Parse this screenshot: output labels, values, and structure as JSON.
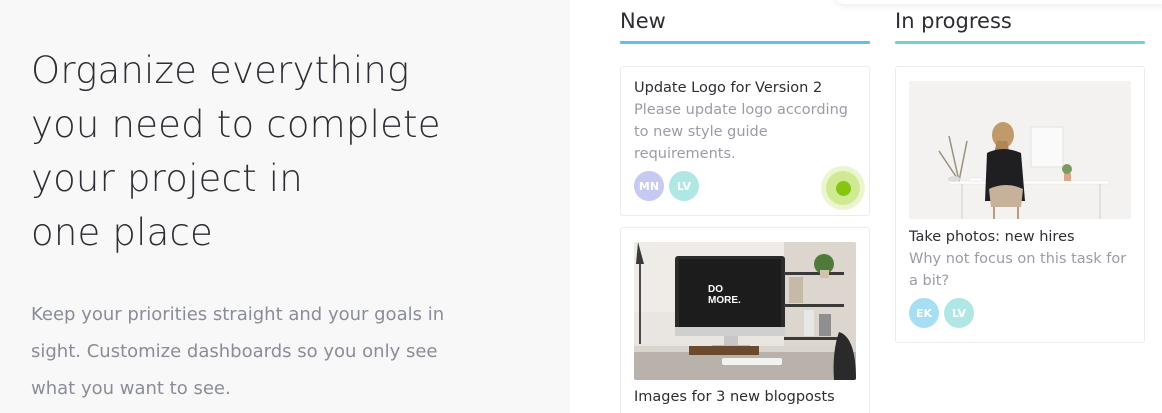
{
  "hero": {
    "heading_lines": [
      "Organize everything",
      "you need to complete",
      "your project in",
      "one place"
    ],
    "subtext": "Keep your priorities straight and your goals in sight. Customize dashboards so you only see what you want to see."
  },
  "board": {
    "columns": [
      {
        "title": "New",
        "accent": "#5fc0e8",
        "cards": [
          {
            "title": "Update Logo for Version 2",
            "description": "Please update logo according to new style guide requirements.",
            "avatars": [
              {
                "initials": "MN",
                "color": "#c6c9f0"
              },
              {
                "initials": "LV",
                "color": "#aee7e3"
              }
            ],
            "status_dot_color": "#86c60e"
          },
          {
            "title": "Images for 3 new blogposts",
            "image": "desk-computer-photo",
            "monitor_text_line1": "DO",
            "monitor_text_line2": "MORE."
          }
        ]
      },
      {
        "title": "In progress",
        "accent": "#6fd3d6",
        "cards": [
          {
            "title": "Take photos: new hires",
            "description": "Why not focus on this task for a bit?",
            "image": "woman-at-desk-photo",
            "avatars": [
              {
                "initials": "EK",
                "color": "#a8def3"
              },
              {
                "initials": "LV",
                "color": "#aee7e3"
              }
            ]
          }
        ]
      }
    ]
  }
}
